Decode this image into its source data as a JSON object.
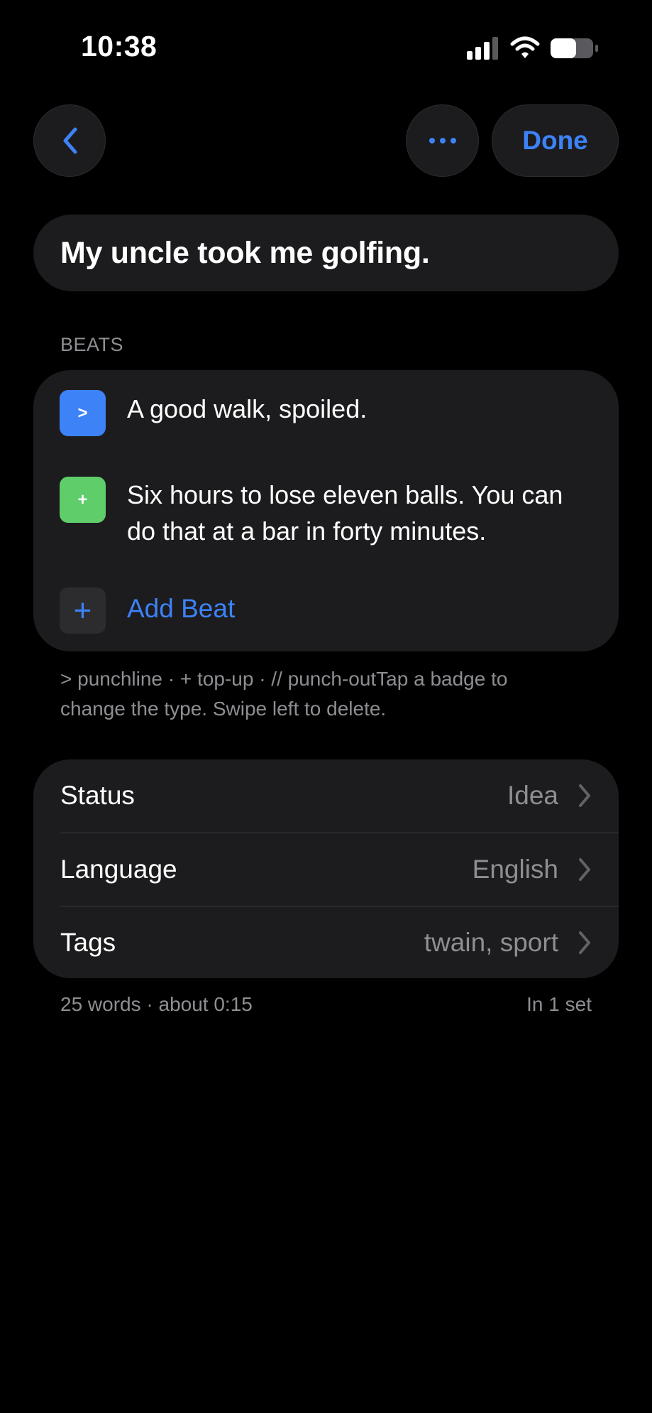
{
  "status_bar": {
    "time": "10:38",
    "icons": [
      "signal-icon",
      "wifi-icon",
      "battery-icon"
    ]
  },
  "nav": {
    "back_icon": "chevron-left-icon",
    "more_icon": "ellipsis-icon",
    "done_label": "Done"
  },
  "title": "My uncle took me golfing.",
  "beats_section": {
    "header": "BEATS",
    "items": [
      {
        "badge": ">",
        "badge_color": "#3d82f6",
        "text": "A good walk, spoiled."
      },
      {
        "badge": "+",
        "badge_color": "#5fcd6a",
        "text": "Six hours to lose eleven balls. You can do that at a bar in forty minutes."
      }
    ],
    "add_badge": "+",
    "add_label": "Add Beat",
    "hint": "> punchline · + top-up · // punch-outTap a badge to change the type. Swipe left to delete."
  },
  "settings": [
    {
      "label": "Status",
      "value": "Idea"
    },
    {
      "label": "Language",
      "value": "English"
    },
    {
      "label": "Tags",
      "value": "twain, sport"
    }
  ],
  "footer": {
    "stats": "25 words · about 0:15",
    "sets": "In 1 set"
  },
  "colors": {
    "background": "#000000",
    "card": "#1c1c1e",
    "accent": "#3d82f6",
    "secondary_text": "#8e8e93"
  }
}
